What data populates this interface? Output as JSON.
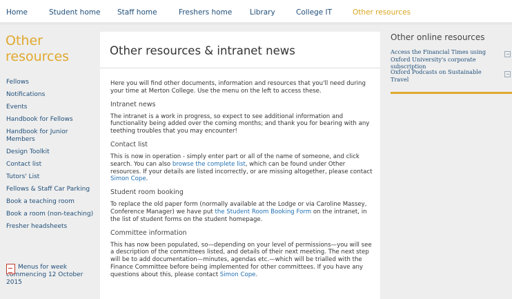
{
  "nav": {
    "items": [
      "Home",
      "Student home",
      "Staff home",
      "Freshers home",
      "Library",
      "College IT",
      "Other resources"
    ]
  },
  "sidebar": {
    "heading": "Other resources",
    "links": [
      "Fellows",
      "Notifications",
      "Events",
      "Handbook for Fellows",
      "Handbook for Junior Members",
      "Design Toolkit",
      "Contact list",
      "Tutors' List",
      "Fellows & Staff Car Parking",
      "Book a teaching room",
      "Book a room (non-teaching)",
      "Fresher headsheets"
    ],
    "pdf_icon": "pdf-file-icon",
    "pdf_link": "Menus for week commencing 12 October 2015"
  },
  "main": {
    "title": "Other resources & intranet news",
    "intro": "Here you will find other documents, information and resources that you'll need during your time at Merton College. Use the menu on the left to access these.",
    "intranet": {
      "heading": "Intranet news",
      "text": "The intranet is a work in progress, so expect to see additional information and functionality being added over the coming months; and thank you for bearing with any teething troubles that you may encounter!"
    },
    "contact": {
      "heading": "Contact list",
      "t1": "This is now in operation - simply enter part or all of the name of someone, and click search. You can also ",
      "link1": "browse the complete list",
      "t2": ", which can be found under Other resources. If your details are listed incorrectly, or are missing altogether, please contact ",
      "link2": "Simon Cope",
      "t3": "."
    },
    "booking": {
      "heading": "Student room booking",
      "t1": "To replace the old paper form (normally available at the Lodge or via Caroline Massey, Conference Manager) we have put ",
      "link1": "the Student Room Booking Form",
      "t2": " on the intranet, in the list of student forms on the student homepage."
    },
    "committee": {
      "heading": "Committee information",
      "t1": "This has now been populated, so—depending on your level of permissions—you will see a description of the committees listed, and details of their next meeting. The next step will be to add documentation—minutes, agendas etc.—which will be trialled with the Finance Committee before being implemented for other committees. If you have any questions about this, please contact ",
      "link1": "Simon Cope",
      "t2": "."
    }
  },
  "right": {
    "title": "Other online resources",
    "items": [
      "Access the Financial Times using Oxford University's corporate subscription",
      "Oxford Podcasts on Sustainable Travel"
    ],
    "ext_icon": "external-link-icon"
  },
  "colors": {
    "accent": "#e0a82e",
    "link": "#1f4e79",
    "inline_link": "#1f6fb2"
  }
}
